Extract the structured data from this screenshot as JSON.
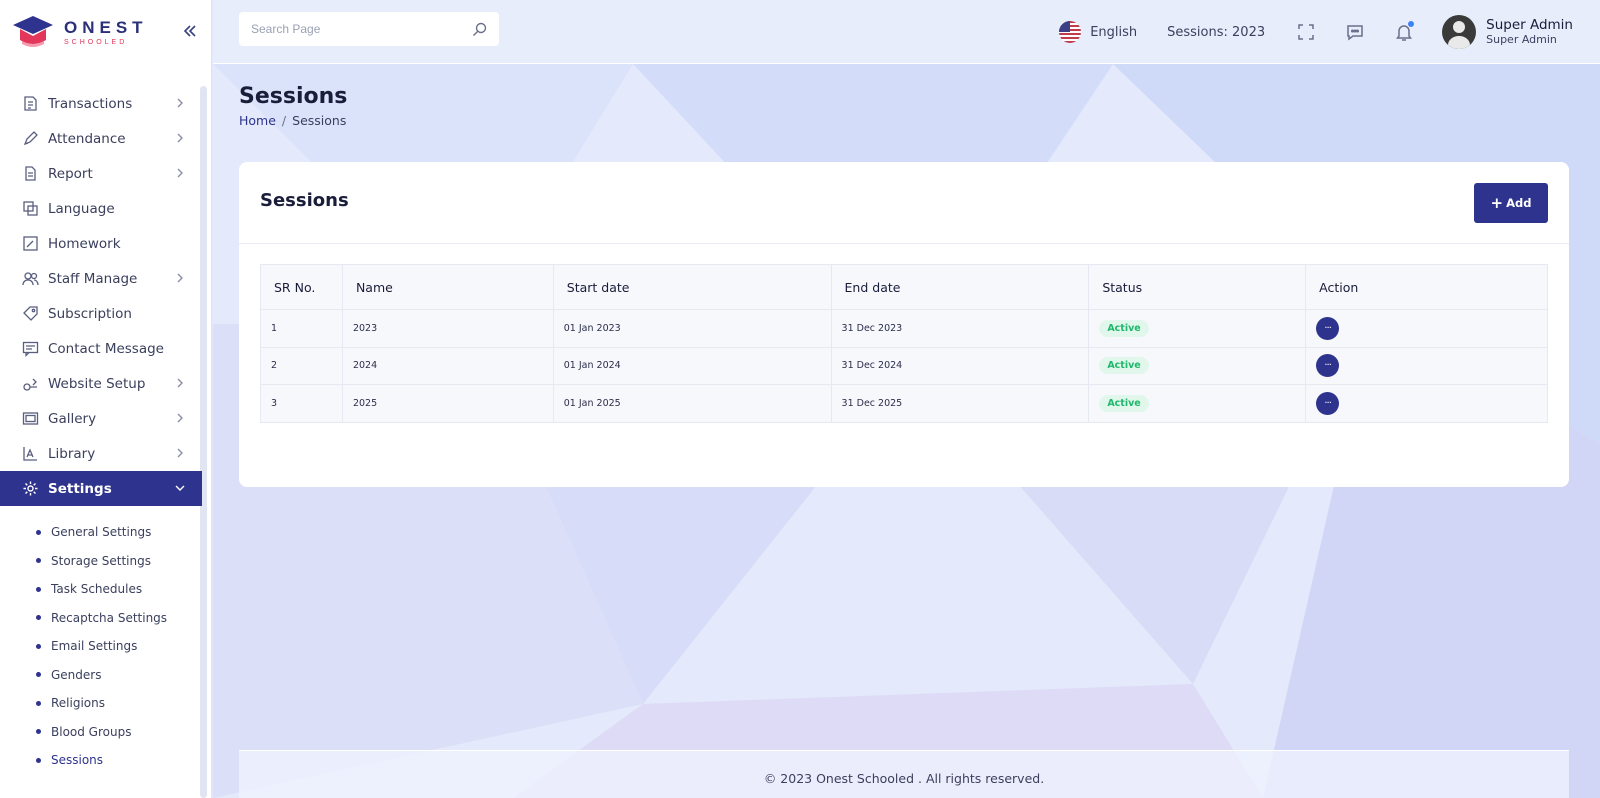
{
  "brand": {
    "name": "ONEST",
    "tagline": "SCHOOLED"
  },
  "colors": {
    "primary": "#2e338d",
    "status_active_bg": "#e2f7ec",
    "status_active_text": "#1fb86c",
    "accent_red": "#e2365a"
  },
  "header": {
    "search_placeholder": "Search Page",
    "language": "English",
    "session": "Sessions: 2023",
    "user": {
      "name": "Super Admin",
      "role": "Super Admin"
    }
  },
  "sidebar": {
    "items": [
      {
        "label": "Transactions",
        "icon": "transaction-icon"
      },
      {
        "label": "Attendance",
        "icon": "attendance-icon"
      },
      {
        "label": "Report",
        "icon": "report-icon"
      },
      {
        "label": "Language",
        "icon": "language-icon"
      },
      {
        "label": "Homework",
        "icon": "homework-icon"
      },
      {
        "label": "Staff Manage",
        "icon": "staff-icon"
      },
      {
        "label": "Subscription",
        "icon": "subscription-icon"
      },
      {
        "label": "Contact Message",
        "icon": "message-icon"
      },
      {
        "label": "Website Setup",
        "icon": "website-icon"
      },
      {
        "label": "Gallery",
        "icon": "gallery-icon"
      },
      {
        "label": "Library",
        "icon": "library-icon"
      },
      {
        "label": "Settings",
        "icon": "gear-icon"
      }
    ],
    "settings_sub": [
      "General Settings",
      "Storage Settings",
      "Task Schedules",
      "Recaptcha Settings",
      "Email Settings",
      "Genders",
      "Religions",
      "Blood Groups",
      "Sessions"
    ]
  },
  "page": {
    "title": "Sessions",
    "breadcrumb": {
      "home": "Home",
      "sep": "/",
      "current": "Sessions"
    }
  },
  "card": {
    "title": "Sessions",
    "add_label": "Add",
    "columns": [
      "SR No.",
      "Name",
      "Start date",
      "End date",
      "Status",
      "Action"
    ],
    "rows": [
      {
        "sr": "1",
        "name": "2023",
        "start": "01 Jan 2023",
        "end": "31 Dec 2023",
        "status": "Active"
      },
      {
        "sr": "2",
        "name": "2024",
        "start": "01 Jan 2024",
        "end": "31 Dec 2024",
        "status": "Active"
      },
      {
        "sr": "3",
        "name": "2025",
        "start": "01 Jan 2025",
        "end": "31 Dec 2025",
        "status": "Active"
      }
    ],
    "action_glyph": "···"
  },
  "footer": {
    "text": "© 2023 Onest Schooled . All rights reserved."
  }
}
